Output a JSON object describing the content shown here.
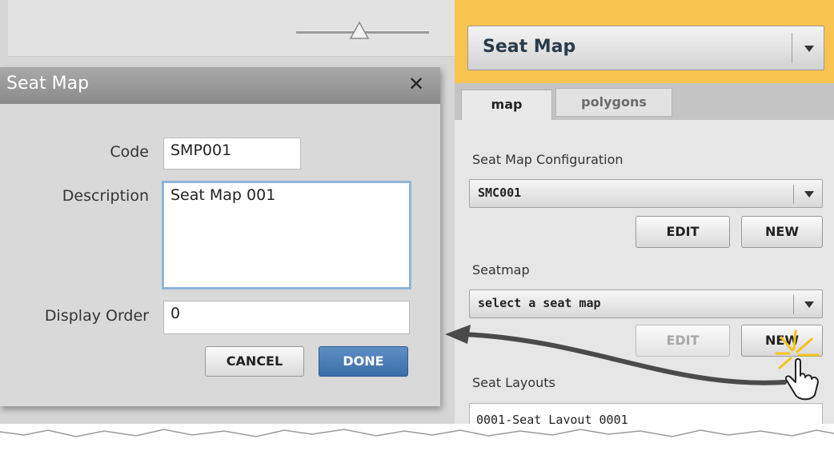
{
  "dialog": {
    "title": "Seat Map",
    "close_glyph": "✕",
    "fields": {
      "code_label": "Code",
      "code_value": "SMP001",
      "description_label": "Description",
      "description_value": "Seat Map 001",
      "display_order_label": "Display Order",
      "display_order_value": "0"
    },
    "buttons": {
      "cancel": "CANCEL",
      "done": "DONE"
    }
  },
  "panel": {
    "main_select_value": "Seat Map",
    "tabs": [
      {
        "label": "map",
        "active": true
      },
      {
        "label": "polygons",
        "active": false
      }
    ],
    "seat_map_configuration": {
      "label": "Seat Map Configuration",
      "selected": "SMC001",
      "edit": "EDIT",
      "new": "NEW"
    },
    "seatmap": {
      "label": "Seatmap",
      "selected": "select a seat map",
      "edit": "EDIT",
      "new": "NEW"
    },
    "seat_layouts": {
      "label": "Seat Layouts",
      "items": [
        "0001-Seat Layout 0001"
      ]
    }
  },
  "colors": {
    "accent_header": "#f9c34f",
    "done_button": "#3b6ea8",
    "dialog_header": "#8a8a8a"
  },
  "icons": {
    "dropdown": "chevron-down-icon",
    "close": "close-icon",
    "pointer": "hand-pointer-icon",
    "arrow": "curved-arrow-icon",
    "slider": "slider-thumb-icon"
  }
}
